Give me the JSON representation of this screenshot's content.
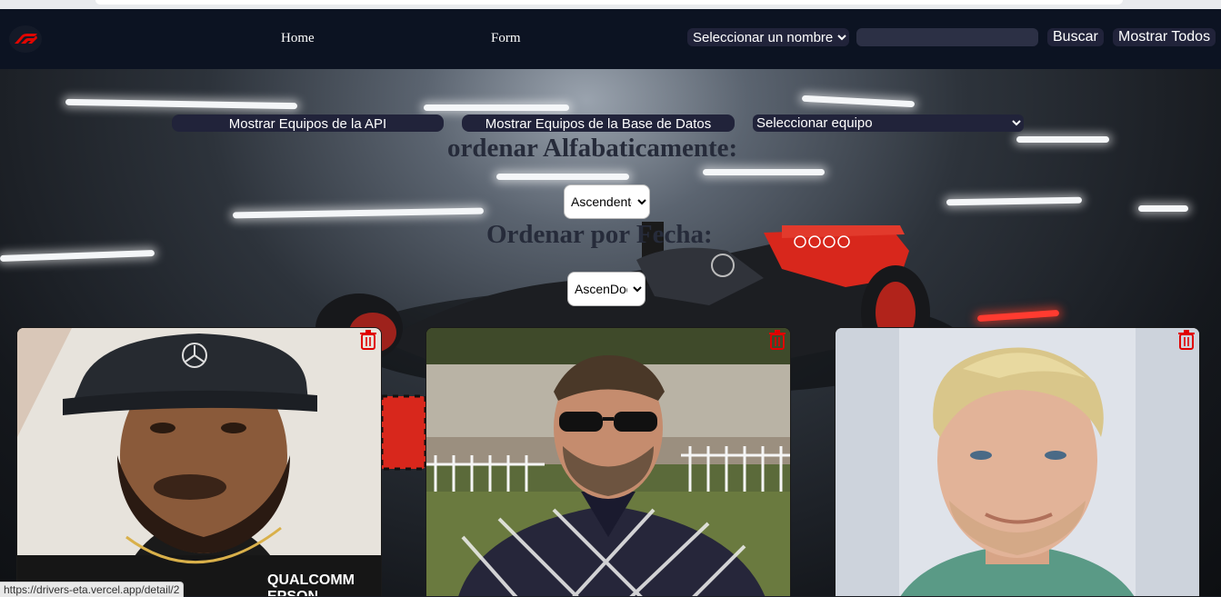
{
  "nav": {
    "home_label": "Home",
    "form_label": "Form",
    "name_select_value": "Seleccionar un nombre",
    "search_value": "",
    "search_button": "Buscar",
    "show_all_button": "Mostrar Todos",
    "logo_icon": "f1-logo-icon"
  },
  "filters": {
    "api_teams_button": "Mostrar Equipos de la API",
    "db_teams_button": "Mostrar Equipos de la Base de Datos",
    "team_select_value": "Seleccionar equipo",
    "alpha_heading": "ordenar Alfabaticamente:",
    "alpha_select_value": "Ascendente",
    "date_heading": "Ordenar por Fecha:",
    "date_select_value": "AscenDod"
  },
  "cards": [
    {
      "photo": "driver-photo-1",
      "delete_icon": "trash-icon"
    },
    {
      "photo": "driver-photo-2",
      "delete_icon": "trash-icon"
    },
    {
      "photo": "driver-photo-3",
      "delete_icon": "trash-icon"
    }
  ],
  "status_url": "https://drivers-eta.vercel.app/detail/2",
  "colors": {
    "navbar_bg": "#0c1322",
    "control_bg": "#21233a",
    "heading_text": "#262b3a",
    "delete_icon": "#e00000",
    "car_red": "#d8271c"
  }
}
